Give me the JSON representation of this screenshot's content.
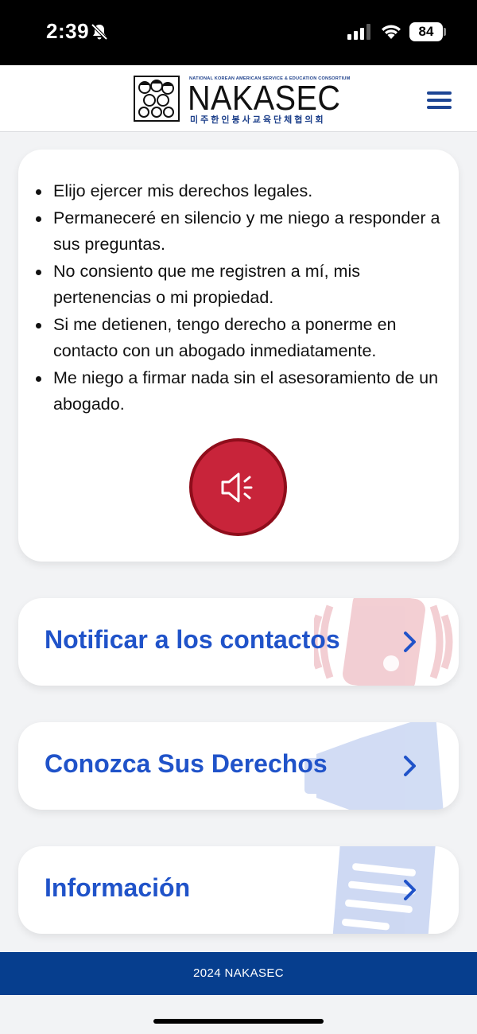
{
  "status_bar": {
    "time": "2:39",
    "battery": "84"
  },
  "header": {
    "logo_small": "NATIONAL KOREAN AMERICAN SERVICE & EDUCATION CONSORTIUM",
    "logo_name": "NAKASEC",
    "logo_korean": "미주한인봉사교육단체협의회"
  },
  "rights": [
    "Elijo ejercer mis derechos legales.",
    "Permaneceré en silencio y me niego a responder a sus preguntas.",
    "No consiento que me registren a mí, mis pertenencias o mi propiedad.",
    "Si me detienen, tengo derecho a ponerme en contacto con un abogado inmediatamente.",
    "Me niego a firmar nada sin el asesoramiento de un abogado."
  ],
  "nav_cards": [
    {
      "label": "Notificar a los contactos"
    },
    {
      "label": "Conozca Sus Derechos"
    },
    {
      "label": "Información"
    }
  ],
  "footer": {
    "text": "2024 NAKASEC"
  },
  "colors": {
    "accent_blue": "#2053c9",
    "footer_blue": "#063e8e",
    "speak_red": "#c8243a",
    "background": "#f2f3f5"
  },
  "icons": {
    "speak_button": "speaker-icon",
    "nav_chevron": "chevron-right-icon",
    "card1_bg": "phone-ringing-icon",
    "card2_bg": "megaphone-icon",
    "card3_bg": "document-icon"
  }
}
